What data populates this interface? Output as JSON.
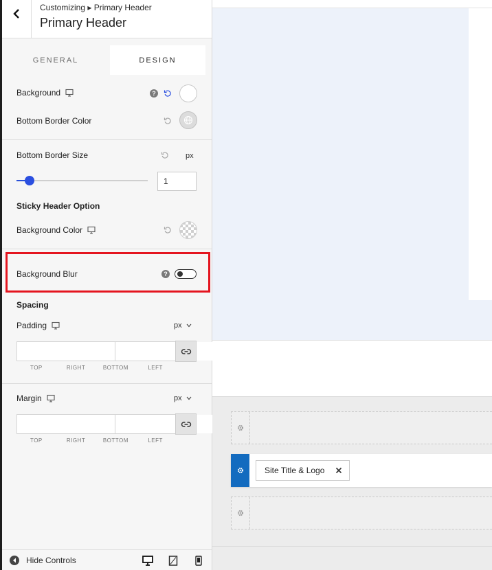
{
  "header": {
    "breadcrumb": "Customizing ▸ Primary Header",
    "title": "Primary Header"
  },
  "tabs": [
    {
      "label": "GENERAL",
      "active": false
    },
    {
      "label": "DESIGN",
      "active": true
    }
  ],
  "design": {
    "background_label": "Background",
    "bottom_border_color_label": "Bottom Border Color",
    "bottom_border_size_label": "Bottom Border Size",
    "bottom_border_size_unit": "px",
    "bottom_border_size_value": "1",
    "bottom_border_size_slider_fraction": 0.1,
    "sticky_header_option_label": "Sticky Header Option",
    "sticky_background_color_label": "Background Color",
    "background_blur_label": "Background Blur",
    "background_blur_enabled": false,
    "spacing_heading": "Spacing",
    "padding_label": "Padding",
    "padding_unit": "px",
    "margin_label": "Margin",
    "margin_unit": "px",
    "side_labels": [
      "TOP",
      "RIGHT",
      "BOTTOM",
      "LEFT"
    ],
    "help_glyph": "?"
  },
  "footer": {
    "hide_controls_label": "Hide Controls",
    "devices": [
      "desktop-icon",
      "tablet-icon",
      "mobile-icon"
    ]
  },
  "builder": {
    "chip_label": "Site Title & Logo"
  },
  "colors": {
    "accent": "#2b4fe0",
    "highlight_border": "#e4151f",
    "builder_active": "#136bbf",
    "preview_bg": "#edf2fa"
  }
}
